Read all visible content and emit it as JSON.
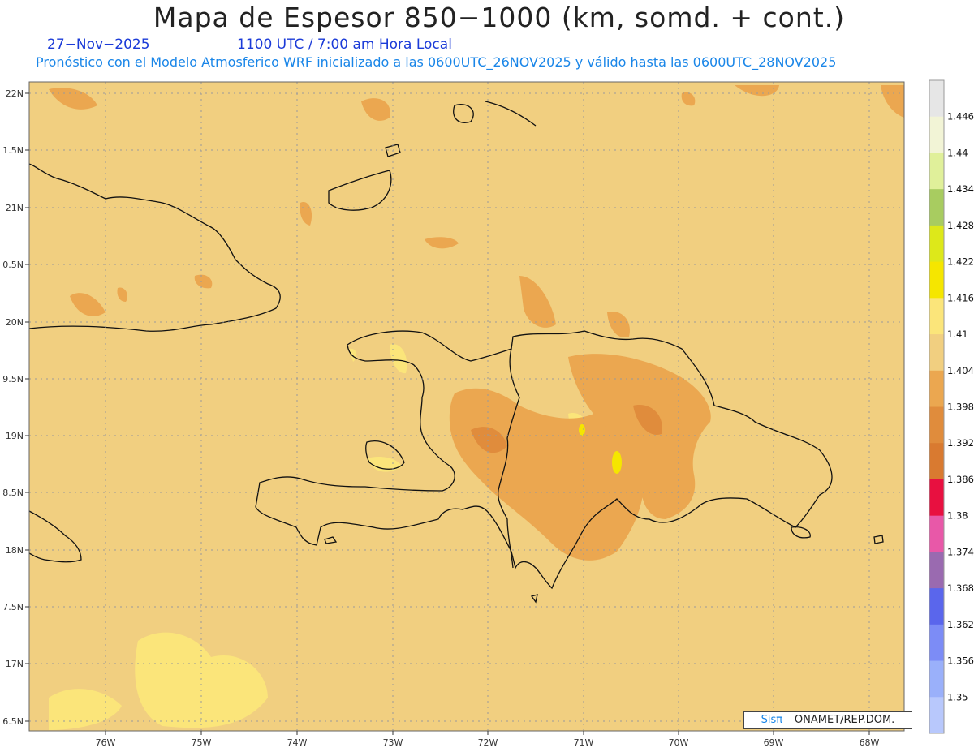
{
  "title": "Mapa de Espesor 850−1000 (km, somd. + cont.)",
  "date": "27−Nov−2025",
  "time": "1100 UTC / 7:00 am Hora Local",
  "subtitle": "Pronóstico con el Modelo Atmosferico WRF inicializado a las 0600UTC_26NOV2025 y válido hasta las  0600UTC_28NOV2025",
  "lat_labels": [
    "22N",
    "1.5N",
    "21N",
    "0.5N",
    "20N",
    "9.5N",
    "19N",
    "8.5N",
    "18N",
    "7.5N",
    "17N",
    "6.5N"
  ],
  "lon_labels": [
    "76W",
    "75W",
    "74W",
    "73W",
    "72W",
    "71W",
    "70W",
    "69W",
    "68W"
  ],
  "colorbar": {
    "labels": [
      "1.446",
      "1.44",
      "1.434",
      "1.428",
      "1.422",
      "1.416",
      "1.41",
      "1.404",
      "1.398",
      "1.392",
      "1.386",
      "1.38",
      "1.374",
      "1.368",
      "1.362",
      "1.356",
      "1.35"
    ],
    "colors": [
      "#e6e6e6",
      "#f2f4d6",
      "#e0f09a",
      "#a8cc60",
      "#dde81a",
      "#f5e600",
      "#fbe57a",
      "#f1cf80",
      "#eba750",
      "#e08c3c",
      "#d97a30",
      "#e81040",
      "#e858a8",
      "#9a6ab0",
      "#5a66ec",
      "#7c8cf6",
      "#9ab0fa",
      "#b8c8fc"
    ]
  },
  "credit": {
    "brand": "Sisπ",
    "text": "– ONAMET/REP.DOM."
  }
}
